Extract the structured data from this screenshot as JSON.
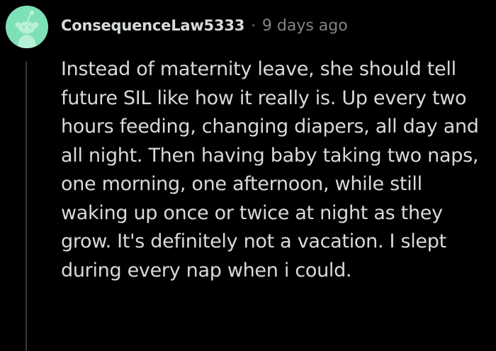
{
  "comment": {
    "avatar_icon": "snoo-avatar-icon",
    "author": "ConsequenceLaw5333",
    "separator": "·",
    "timestamp": "9 days ago",
    "body": "Instead of maternity leave, she should tell future SIL like how it really is. Up every two hours feeding, changing diapers, all day and all night. Then having baby taking two naps, one morning, one afternoon, while still waking up once or twice at night as they grow. It's definitely not a vacation. I slept during every nap when i could."
  },
  "colors": {
    "background": "#000000",
    "text": "#d7dadc",
    "meta": "#818384",
    "avatar_bg": "#7ee0b6",
    "thread_line": "#343536"
  }
}
